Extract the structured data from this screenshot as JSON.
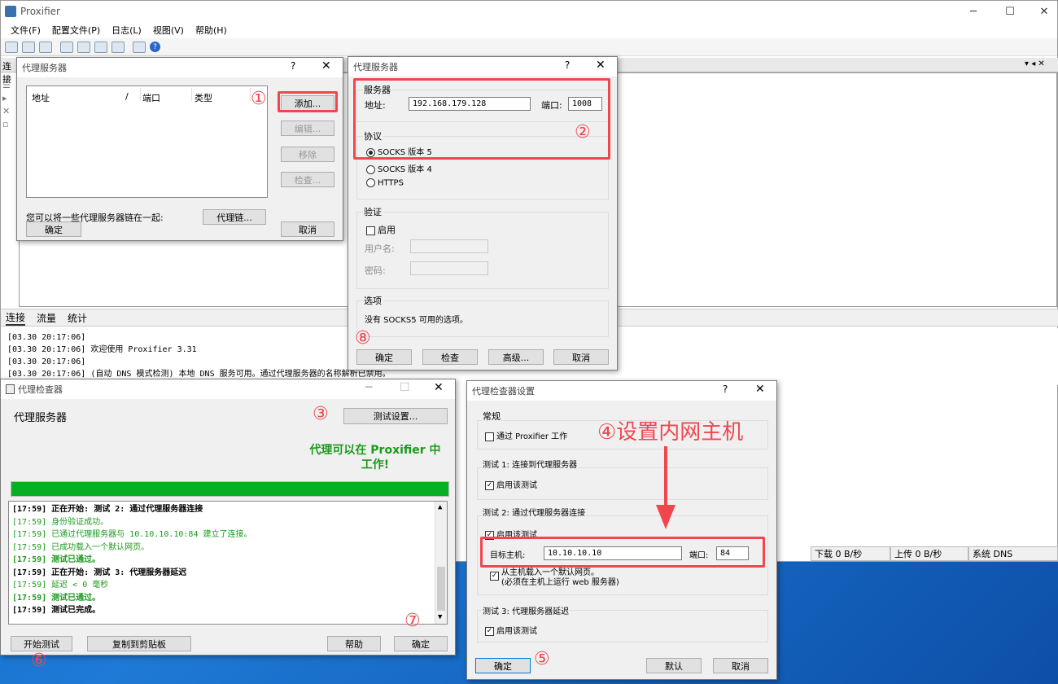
{
  "app": {
    "title": "Proxifier",
    "menu": [
      "文件(F)",
      "配置文件(P)",
      "日志(L)",
      "视图(V)",
      "帮助(H)"
    ],
    "content_header": "连接",
    "tabs": [
      "连接",
      "流量",
      "统计"
    ],
    "log_lines": [
      "[03.30 20:17:06]",
      "[03.30 20:17:06]     欢迎使用 Proxifier 3.31",
      "[03.30 20:17:06]",
      "[03.30 20:17:06] (自动 DNS 模式检测) 本地 DNS 服务可用。通过代理服务器的名称解析已禁用。"
    ],
    "status": {
      "download": "下载 0 B/秒",
      "upload": "上传 0 B/秒",
      "dns": "系统 DNS"
    }
  },
  "proxy_list_dialog": {
    "title": "代理服务器",
    "columns": [
      "地址",
      "/",
      "端口",
      "类型"
    ],
    "buttons": {
      "add": "添加...",
      "edit": "编辑...",
      "remove": "移除",
      "check": "检查..."
    },
    "chain_text": "您可以将一些代理服务器链在一起:",
    "chain_button": "代理链...",
    "ok": "确定",
    "cancel": "取消"
  },
  "proxy_edit_dialog": {
    "title": "代理服务器",
    "server_group": "服务器",
    "address_label": "地址:",
    "address_value": "192.168.179.128",
    "port_label": "端口:",
    "port_value": "1008",
    "protocol_group": "协议",
    "protocols": [
      "SOCKS 版本 5",
      "SOCKS 版本 4",
      "HTTPS"
    ],
    "selected_protocol": 0,
    "auth_group": "验证",
    "enable_label": "启用",
    "username_label": "用户名:",
    "password_label": "密码:",
    "options_group": "选项",
    "options_text": "没有 SOCKS5 可用的选项。",
    "buttons": {
      "ok": "确定",
      "check": "检查",
      "advanced": "高级...",
      "cancel": "取消"
    }
  },
  "proxy_checker": {
    "title": "代理检查器",
    "heading": "代理服务器",
    "test_settings_button": "测试设置...",
    "result_line1": "代理可以在 Proxifier 中",
    "result_line2": "工作!",
    "progress": 1.0,
    "log": [
      {
        "t": "[17:59]  正在开始: 测试 2: 通过代理服务器连接",
        "style": "b"
      },
      {
        "t": "[17:59] 身份验证成功。",
        "style": "g"
      },
      {
        "t": "[17:59] 已通过代理服务器与 10.10.10.10:84 建立了连接。",
        "style": "g"
      },
      {
        "t": "[17:59] 已成功载入一个默认网页。",
        "style": "g"
      },
      {
        "t": "[17:59]  测试已通过。",
        "style": "bg"
      },
      {
        "t": "[17:59]  正在开始: 测试 3: 代理服务器延迟",
        "style": "b"
      },
      {
        "t": "[17:59] 延迟 < 0 毫秒",
        "style": "g"
      },
      {
        "t": "[17:59]  测试已通过。",
        "style": "bg"
      },
      {
        "t": "[17:59]  测试已完成。",
        "style": "b"
      }
    ],
    "buttons": {
      "start": "开始测试",
      "copy": "复制到剪贴板",
      "help": "帮助",
      "ok": "确定"
    }
  },
  "checker_settings": {
    "title": "代理检查器设置",
    "general_group": "常规",
    "via_proxifier": "通过 Proxifier 工作",
    "test1_group": "测试 1: 连接到代理服务器",
    "test2_group": "测试 2: 通过代理服务器连接",
    "test3_group": "测试 3: 代理服务器延迟",
    "enable_test": "启用该测试",
    "target_host_label": "目标主机:",
    "target_host_value": "10.10.10.10",
    "port_label": "端口:",
    "port_value": "84",
    "load_page_line1": "从主机载入一个默认网页。",
    "load_page_line2": "(必须在主机上运行 web 服务器)",
    "buttons": {
      "ok": "确定",
      "default": "默认",
      "cancel": "取消"
    }
  },
  "annotations": {
    "n1": "①",
    "n2": "②",
    "n3": "③",
    "n4": "④设置内网主机",
    "n5": "⑤",
    "n6": "⑥",
    "n7": "⑦",
    "n8": "⑧",
    "color": "#f0474f"
  },
  "colors": {
    "success_green": "#1d9a1d",
    "progress_green": "#06b025"
  }
}
